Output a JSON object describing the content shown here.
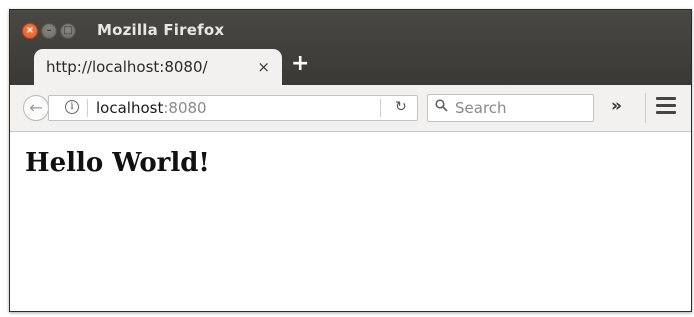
{
  "window": {
    "title": "Mozilla Firefox",
    "controls": {
      "close": "×",
      "minimize": "–",
      "maximize": "□"
    }
  },
  "tabs": [
    {
      "label": "http://localhost:8080/",
      "close": "×"
    }
  ],
  "new_tab": "+",
  "navbar": {
    "back": "←",
    "url_host": "localhost",
    "url_port": ":8080",
    "reload": "↻",
    "search_placeholder": "Search",
    "overflow": "»"
  },
  "page": {
    "heading": "Hello World!"
  },
  "colors": {
    "titlebar": "#3c3b37",
    "toolbar": "#f2f1f0",
    "close_button": "#e25a25"
  }
}
